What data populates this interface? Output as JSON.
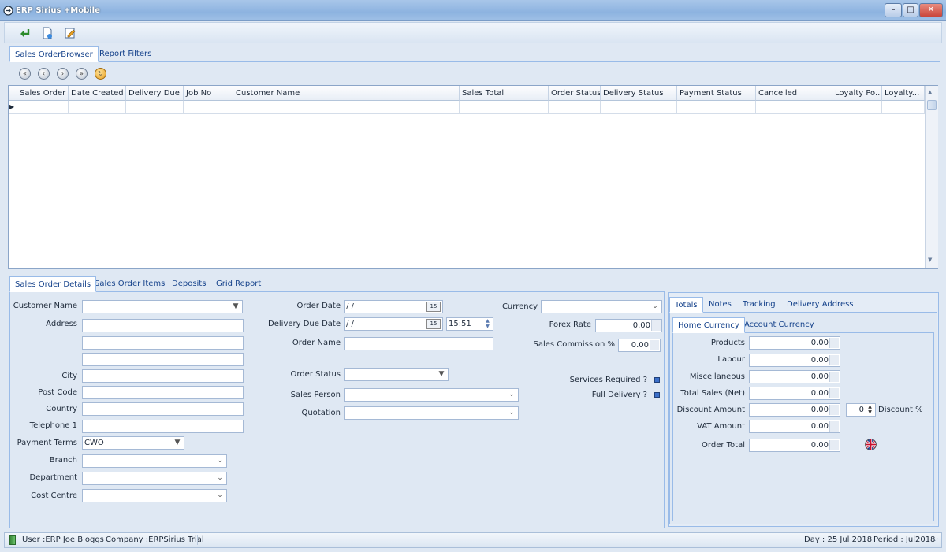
{
  "window": {
    "title": "ERP Sirius +Mobile",
    "controls": [
      "–",
      "□",
      "✕"
    ]
  },
  "toolbar": {
    "icons": [
      "return-icon",
      "new-document-icon",
      "edit-document-icon"
    ]
  },
  "top_tabs": [
    {
      "label": "Sales OrderBrowser",
      "active": true
    },
    {
      "label": "Report Filters",
      "active": false
    }
  ],
  "nav_buttons": [
    "first",
    "previous",
    "next",
    "last",
    "refresh"
  ],
  "grid": {
    "columns": [
      "Sales Order",
      "Date Created",
      "Delivery Due",
      "Job No",
      "Customer Name",
      "Sales Total",
      "Order Status",
      "Delivery Status",
      "Payment Status",
      "Cancelled",
      "Loyalty Po...",
      "Loyalty..."
    ]
  },
  "detail_tabs": [
    {
      "label": "Sales Order Details",
      "active": true
    },
    {
      "label": "Sales Order Items",
      "active": false
    },
    {
      "label": "Deposits",
      "active": false
    },
    {
      "label": "Grid Report",
      "active": false
    }
  ],
  "form": {
    "customer_name_label": "Customer Name",
    "address_label": "Address",
    "city_label": "City",
    "post_code_label": "Post Code",
    "country_label": "Country",
    "telephone_label": "Telephone 1",
    "payment_terms_label": "Payment Terms",
    "payment_terms_value": "CWO",
    "branch_label": "Branch",
    "department_label": "Department",
    "cost_centre_label": "Cost Centre",
    "order_date_label": "Order Date",
    "order_date_value": " / /",
    "delivery_due_label": "Delivery Due Date",
    "delivery_due_value": " / /",
    "delivery_time_value": "15:51",
    "calendar_glyph": "15",
    "order_name_label": "Order Name",
    "order_status_label": "Order Status",
    "sales_person_label": "Sales Person",
    "quotation_label": "Quotation",
    "currency_label": "Currency",
    "forex_rate_label": "Forex Rate",
    "forex_rate_value": "0.00",
    "sales_commission_label": "Sales Commission %",
    "sales_commission_value": "0.00",
    "services_required_label": "Services Required ?",
    "full_delivery_label": "Full Delivery ?"
  },
  "totals_tabs": [
    {
      "label": "Totals",
      "active": true
    },
    {
      "label": "Notes",
      "active": false
    },
    {
      "label": "Tracking",
      "active": false
    },
    {
      "label": "Delivery Address",
      "active": false
    }
  ],
  "currency_tabs": [
    {
      "label": "Home Currency",
      "active": true
    },
    {
      "label": "Account Currency",
      "active": false
    }
  ],
  "totals": {
    "products_label": "Products",
    "products_value": "0.00",
    "labour_label": "Labour",
    "labour_value": "0.00",
    "misc_label": "Miscellaneous",
    "misc_value": "0.00",
    "total_sales_label": "Total Sales (Net)",
    "total_sales_value": "0.00",
    "discount_amount_label": "Discount Amount",
    "discount_amount_value": "0.00",
    "discount_pct_value": "0",
    "discount_pct_label": "Discount %",
    "vat_label": "VAT Amount",
    "vat_value": "0.00",
    "order_total_label": "Order Total",
    "order_total_value": "0.00"
  },
  "status": {
    "user": "User :ERP Joe Bloggs",
    "company": "Company :ERPSirius Trial",
    "day": "Day : 25 Jul 2018",
    "period": "Period : Jul2018"
  },
  "colors": {
    "title_bar": "#8db3e0",
    "tab_text": "#15428b",
    "close_button": "#d9534f",
    "checkbox": "#3b6fc9"
  }
}
